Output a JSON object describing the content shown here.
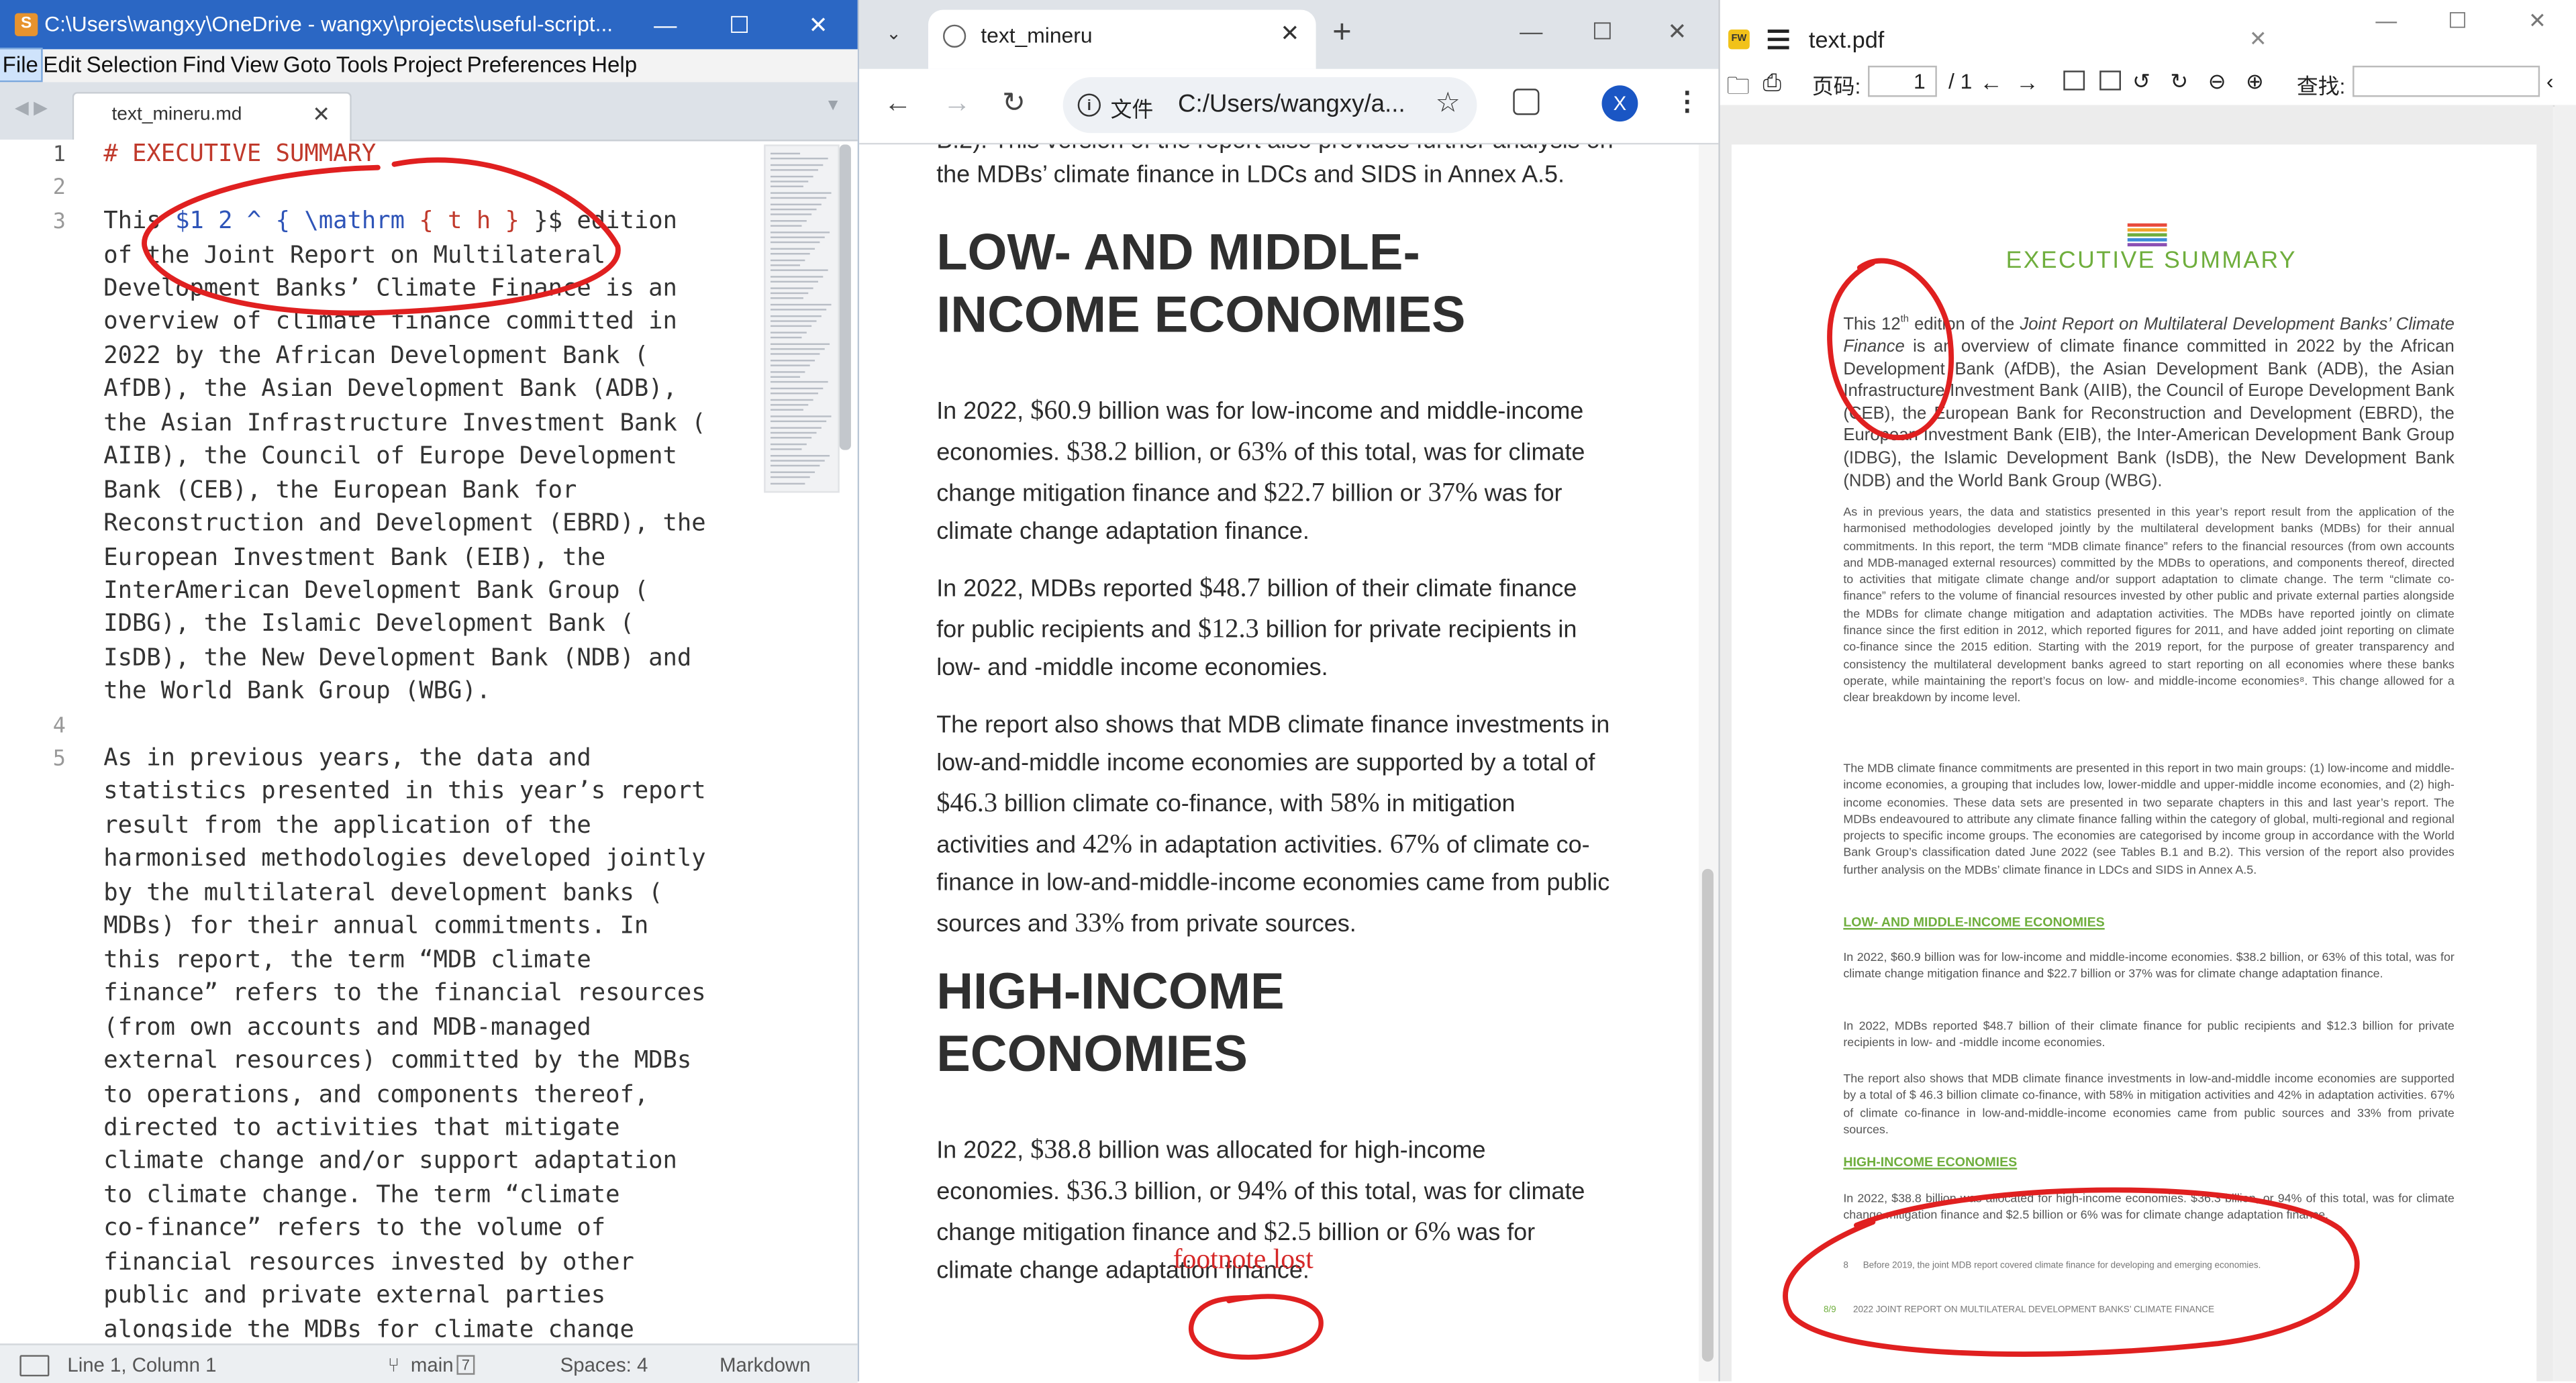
{
  "sublime": {
    "title": "C:\\Users\\wangxy\\OneDrive - wangxy\\projects\\useful-script...",
    "menu": [
      "File",
      "Edit",
      "Selection",
      "Find",
      "View",
      "Goto",
      "Tools",
      "Project",
      "Preferences",
      "Help"
    ],
    "tab_label": "text_mineru.md",
    "line_numbers": [
      "1",
      "2",
      "3",
      "4",
      "5"
    ],
    "code": {
      "l1_hash": "#",
      "l1_text": " EXECUTIVE SUMMARY",
      "l3a_pre": "This ",
      "l3a_math": "$1 2 ^ { \\mathrm",
      "l3a_brace": " { t h }",
      "l3a_post": " }$ edition",
      "wrapped_3": [
        "of the Joint Report on Multilateral",
        "Development Banks’ Climate Finance is an",
        "overview of climate finance committed in",
        "2022 by the African Development Bank (",
        "AfDB), the Asian Development Bank (ADB),",
        "the Asian Infrastructure Investment Bank (",
        "AIIB), the Council of Europe Development",
        "Bank (CEB), the European Bank for",
        "Reconstruction and Development (EBRD), the",
        "European Investment Bank (EIB), the",
        "InterAmerican Development Bank Group (",
        "IDBG), the Islamic Development Bank (",
        "IsDB), the New Development Bank (NDB) and",
        "the World Bank Group (WBG)."
      ],
      "wrapped_5": [
        "As in previous years, the data and",
        "statistics presented in this year’s report",
        "result from the application of the",
        "harmonised methodologies developed jointly",
        "by the multilateral development banks (",
        "MDBs) for their annual commitments. In",
        "this report, the term “MDB climate",
        "finance” refers to the financial resources",
        "(from own accounts and MDB-managed",
        "external resources) committed by the MDBs",
        "to operations, and components thereof,",
        "directed to activities that mitigate",
        "climate change and/or support adaptation",
        "to climate change. The term “climate",
        "co-finance” refers to the volume of",
        "financial resources invested by other",
        "public and private external parties",
        "alongside the MDBs for climate change"
      ]
    },
    "status": {
      "position": "Line 1, Column 1",
      "branch": "main",
      "branch_badge": "7",
      "indent": "Spaces: 4",
      "syntax": "Markdown"
    }
  },
  "chrome": {
    "tab_title": "text_mineru",
    "url_tag": "文件",
    "url": "C:/Users/wangxy/a...",
    "avatar_letter": "X",
    "partial_top_line": "B.2). This version of the report also provides further analysis on",
    "top_line": "the MDBs’ climate finance in LDCs and SIDS in Annex A.5.",
    "h2_low": [
      "LOW- AND MIDDLE-",
      "INCOME ECONOMIES"
    ],
    "h2_high": [
      "HIGH-INCOME",
      "ECONOMIES"
    ],
    "p1": {
      "a": "In 2022, ",
      "n1": "$60.9",
      "b": " billion was for low-income and middle-income economies. ",
      "n2": "$38.2",
      "c": " billion, or ",
      "n3": "63%",
      "d": " of this total, was for climate change mitigation finance and ",
      "n4": "$22.7",
      "e": " billion or ",
      "n5": "37%",
      "f": " was for climate change adaptation finance."
    },
    "p2": {
      "a": "In 2022, MDBs reported ",
      "n1": "$48.7",
      "b": " billion of their climate finance for public recipients and ",
      "n2": "$12.3",
      "c": " billion for private recipients in low- and -middle income economies."
    },
    "p3": {
      "a": "The report also shows that MDB climate finance investments in low-and-middle income economies are supported by a total of ",
      "n1": "$46.3",
      "b": " billion climate co-finance, with ",
      "n2": "58%",
      "c": " in mitigation activities and ",
      "n3": "42%",
      "d": " in adaptation activities. ",
      "n4": "67%",
      "e": " of climate co-finance in low-and-middle-income economies came from public sources and ",
      "n5": "33%",
      "f": " from private sources."
    },
    "p4": {
      "a": "In 2022, ",
      "n1": "$38.8",
      "b": " billion was allocated for high-income economies. ",
      "n2": "$36.3",
      "c": " billion, or ",
      "n3": "94%",
      "d": " of this total, was for climate change mitigation finance and ",
      "n4": "$2.5",
      "e": " billion or ",
      "n5": "6%",
      "f": " was for climate change adaptation finance."
    },
    "annotation": "footnote lost"
  },
  "pdf": {
    "title": "text.pdf",
    "page_label": "页码:",
    "page_value": "1",
    "page_total": "/ 1",
    "find_label": "查找:",
    "exec_title": "EXECUTIVE SUMMARY",
    "lead_a": "This 12",
    "lead_sup": "th",
    "lead_b": " edition of the ",
    "lead_italic": "Joint Report on Multilateral Development Banks’ Climate Finance",
    "lead_c": " is an overview of climate finance committed in 2022 by the African Development Bank (AfDB), the Asian Development Bank (ADB), the Asian Infrastructure Investment Bank (AIIB), the Council of Europe Development Bank (CEB), the European Bank for Reconstruction and Development (EBRD), the European Investment Bank (EIB), the Inter-American Development Bank Group (IDBG), the Islamic Development Bank (IsDB), the New Development Bank (NDB) and the World Bank Group (WBG).",
    "para2": "As in previous years, the data and statistics presented in this year’s report result from the application of the harmonised methodologies developed jointly by the multilateral development banks (MDBs) for their annual commitments. In this report, the term “MDB climate finance” refers to the financial resources (from own accounts and MDB-managed external resources) committed by the MDBs to operations, and components thereof, directed to activities that mitigate climate change and/or support adaptation to climate change. The term “climate co-finance” refers to the volume of financial resources invested by other public and private external parties alongside the MDBs for climate change mitigation and adaptation activities. The MDBs have reported jointly on climate finance since the first edition in 2012, which reported figures for 2011, and have added joint reporting on climate co-finance since the 2015 edition. Starting with the 2019 report, for the purpose of greater transparency and consistency the multilateral development banks agreed to start reporting on all economies where these banks operate, while maintaining the report’s focus on low- and middle-income economies⁸. This change allowed for a clear breakdown by income level.",
    "para3": "The MDB climate finance commitments are presented in this report in two main groups: (1) low-income and middle-income economies, a grouping that includes low, lower-middle and upper-middle income economies, and (2) high-income economies. These data sets are presented in two separate chapters in this and last year’s report. The MDBs endeavoured to attribute any climate finance falling within the category of global, multi-regional and regional projects to specific income groups. The economies are categorised by income group in accordance with the World Bank Group’s classification dated June 2022 (see Tables B.1 and B.2). This version of the report also provides further analysis on the MDBs’ climate finance in LDCs and SIDS in Annex A.5.",
    "sub1": "LOW- AND MIDDLE-INCOME ECONOMIES",
    "para4": "In 2022, $60.9 billion was for low-income and middle-income economies. $38.2 billion, or 63% of this total, was for climate change mitigation finance and $22.7 billion or 37% was for climate change adaptation finance.",
    "para5": "In 2022, MDBs reported $48.7 billion of their climate finance for public recipients and $12.3 billion for private recipients in low- and -middle income economies.",
    "para6": "The report also shows that MDB climate finance investments in low-and-middle income economies are supported by a total of $ 46.3 billion climate co-finance, with 58% in mitigation activities and 42% in adaptation activities. 67% of climate co-finance in low-and-middle-income economies came from public sources and 33% from private sources.",
    "sub2": "HIGH-INCOME ECONOMIES",
    "para7": "In 2022, $38.8 billion was allocated for high-income economies. $36.3 billion, or 94% of this total, was for climate change mitigation finance and $2.5 billion or 6% was for climate change adaptation finance.",
    "footnote_num": "8",
    "footnote": "Before 2019, the joint MDB report covered climate finance for developing and emerging economies.",
    "page_num": "8/9",
    "running_footer": "2022 JOINT REPORT ON MULTILATERAL DEVELOPMENT BANKS’ CLIMATE FINANCE"
  },
  "colors": {
    "sublime_title": "#2b67c4",
    "heading_red": "#c0392b",
    "math_blue": "#2e54b8",
    "pdf_green": "#6fae3d",
    "ink_red": "#e02020",
    "chrome_avatar": "#1a56c4"
  }
}
